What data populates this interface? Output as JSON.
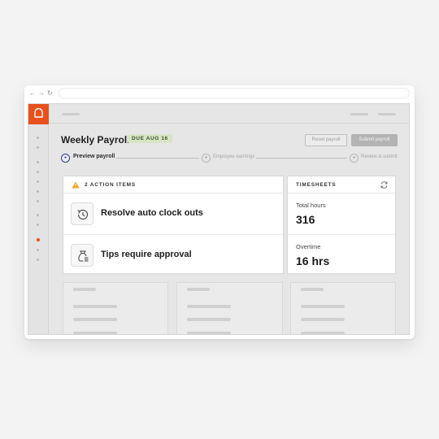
{
  "browser": {
    "nav": {
      "back": "←",
      "forward": "→",
      "reload": "↻"
    }
  },
  "page": {
    "title": "Weekly Payroll",
    "due_badge": "DUE AUG 16",
    "buttons": {
      "reset": "Reset payroll",
      "submit": "Submit payroll"
    }
  },
  "steps": [
    {
      "label": "Preview payroll",
      "current": true
    },
    {
      "label": "Employee earnings",
      "current": false
    },
    {
      "label": "Review & submit",
      "current": false
    }
  ],
  "action_items": {
    "header": "2 ACTION ITEMS",
    "items": [
      {
        "label": "Resolve auto clock outs",
        "icon": "history-clock-icon"
      },
      {
        "label": "Tips require approval",
        "icon": "money-bag-icon"
      }
    ]
  },
  "timesheets": {
    "header": "TIMESHEETS",
    "total_hours": {
      "label": "Total hours",
      "value": "316"
    },
    "overtime": {
      "label": "Overtime",
      "value": "16 hrs"
    }
  },
  "colors": {
    "brand": "#e8501c",
    "step_active": "#2c3c8c",
    "due_badge_bg": "#d7e4c6",
    "warning": "#f0a21b"
  }
}
